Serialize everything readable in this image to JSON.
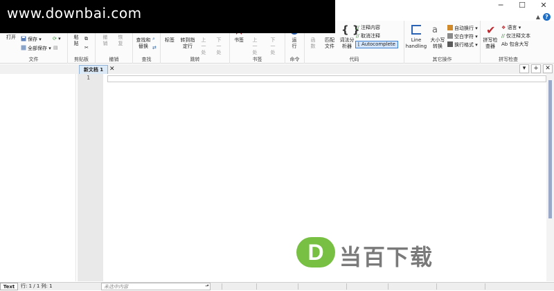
{
  "watermark_top": "www.downbai.com",
  "window": {
    "min": "─",
    "max": "☐",
    "close": "✕",
    "help": "?"
  },
  "ribbon": {
    "file": {
      "open": "打开",
      "save": "保存",
      "save_all": "全部保存",
      "label": "文件"
    },
    "clipboard": {
      "paste": "粘贴",
      "label": "剪贴板"
    },
    "undo": {
      "undo": "撤销",
      "redo": "恢复",
      "label": "撤销"
    },
    "find": {
      "find_replace": "查找和替换",
      "label": "查找"
    },
    "jump": {
      "bookmark": "标签",
      "goto_line": "转到指定行",
      "prev": "上一处",
      "next": "下一处",
      "label": "跳转"
    },
    "bookmarks": {
      "bookmark": "书签",
      "prev": "上一处",
      "next": "下一处",
      "label": "书签"
    },
    "command": {
      "run": "运行",
      "label": "命令"
    },
    "code": {
      "func": "函数",
      "match_file": "匹配文件",
      "lexer": "词法分析器",
      "comment": "注释内容",
      "uncomment": "取消注释",
      "autocomplete": "Autocomplete",
      "label": "代码"
    },
    "other": {
      "line_handling": "Line handling",
      "case_convert": "大小写转换",
      "auto_wrap": "自动换行",
      "whitespace": "空白字符",
      "wrap_format": "换行格式",
      "label": "其它操作"
    },
    "spell": {
      "spellcheck": "拼写检查器",
      "language": "语言",
      "comments_only": "仅注释文本",
      "include_upper": "包含大写",
      "label": "拼写检查"
    }
  },
  "tabs": {
    "active": "新文档 1",
    "close": "✕",
    "dropdown": "▾",
    "add": "+",
    "close_all": "✕"
  },
  "editor": {
    "line_number": "1"
  },
  "logo": {
    "letter": "D",
    "text": "当百下载"
  },
  "status": {
    "mode": "Text",
    "position": "行: 1 / 1   列: 1",
    "selection": "未选中内容",
    "arrow": "⬏"
  }
}
